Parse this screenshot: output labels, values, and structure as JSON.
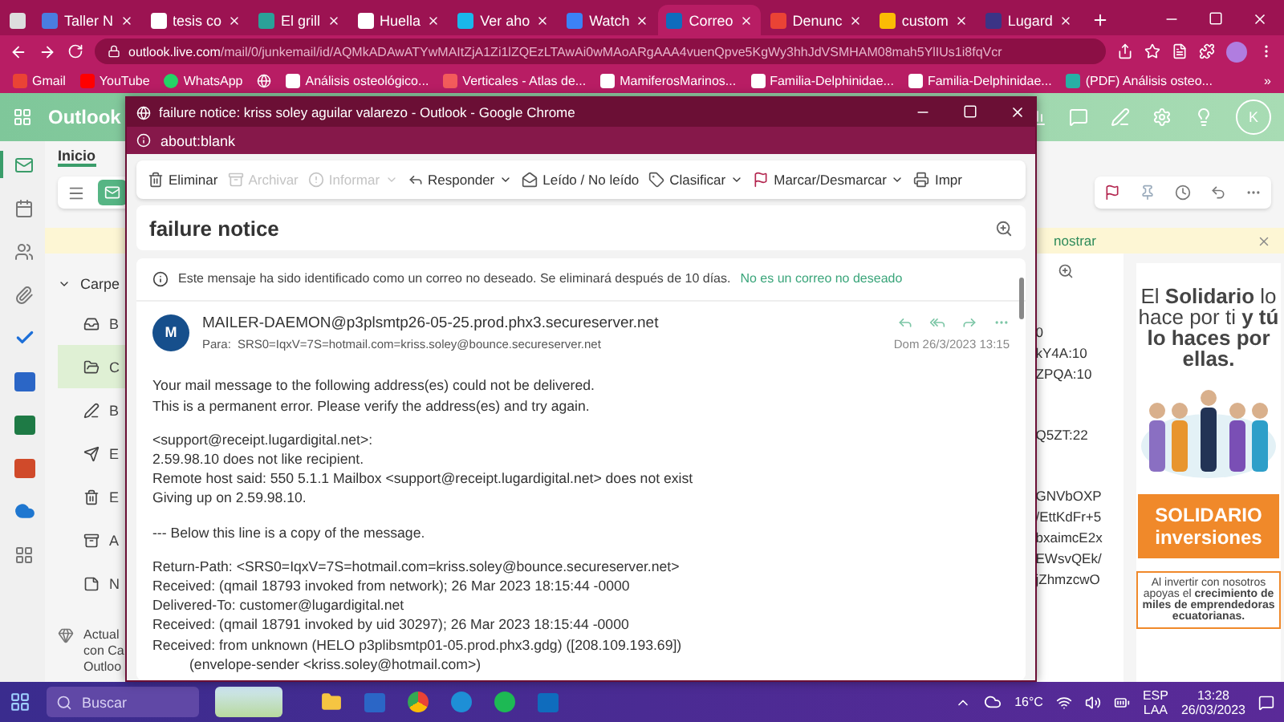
{
  "browser": {
    "tabs": [
      {
        "label": "Taller N",
        "selected": false
      },
      {
        "label": "tesis co",
        "selected": false
      },
      {
        "label": "El grill",
        "selected": false
      },
      {
        "label": "Huella",
        "selected": false
      },
      {
        "label": "Ver aho",
        "selected": false
      },
      {
        "label": "Watch",
        "selected": false
      },
      {
        "label": "Correo",
        "selected": true
      },
      {
        "label": "Denunc",
        "selected": false
      },
      {
        "label": "custom",
        "selected": false
      },
      {
        "label": "Lugard",
        "selected": false
      }
    ],
    "url_host": "outlook.live.com",
    "url_path": "/mail/0/junkemail/id/AQMkADAwATYwMAItZjA1Zi1lZQEzLTAwAi0wMAoARgAAA4vuenQpve5KgWy3hhJdVSMHAM08mah5YlIUs1i8fqVcr",
    "bookmarks": [
      "Gmail",
      "YouTube",
      "WhatsApp",
      "Análisis osteológico...",
      "Verticales - Atlas de...",
      "MamiferosMarinos...",
      "Familia-Delphinidae...",
      "Familia-Delphinidae...",
      "(PDF) Análisis osteo..."
    ],
    "bookmarks_more": "»"
  },
  "outlook": {
    "app_name": "Outlook",
    "avatar_initial": "K",
    "rail": [
      {
        "selected": true
      },
      {
        "selected": false
      },
      {
        "selected": false
      },
      {
        "selected": false
      },
      {
        "selected": false
      },
      {
        "selected": false
      },
      {
        "selected": false
      },
      {
        "selected": false
      },
      {
        "selected": false
      },
      {
        "selected": false
      }
    ],
    "ribbon_tab": "Inicio",
    "banner_link": "nostrar",
    "folders_header": "Carpe",
    "folders": [
      {
        "label": "B",
        "selected": false
      },
      {
        "label": "C",
        "selected": true
      },
      {
        "label": "B",
        "selected": false
      },
      {
        "label": "E",
        "selected": false
      },
      {
        "label": "E",
        "selected": false
      },
      {
        "label": "A",
        "selected": false
      },
      {
        "label": "N",
        "selected": false
      }
    ],
    "upgrade_lines": [
      "Actual",
      "con Ca",
      "Outloo"
    ],
    "reading_fragments": [
      [
        "0",
        "kY4A:10",
        "ZPQA:10"
      ],
      [
        "Q5ZT:22"
      ],
      [
        "GNVbOXP",
        "/EttKdFr+5",
        "bxaimcE2x",
        "EWsvQEk/",
        "jZhmzcwO"
      ]
    ],
    "ad": {
      "headline": "El **Solidario** lo hace por ti **y tú lo haces por ellas.**",
      "brand": "SOLIDARIO",
      "product": "inversiones",
      "text": "Al invertir con nosotros apoyas el **crecimiento de miles de emprendedoras ecuatorianas.**"
    }
  },
  "popup": {
    "title": "failure notice: kriss soley aguilar valarezo - Outlook - Google Chrome",
    "address": "about:blank",
    "toolbar": [
      {
        "label": "Eliminar",
        "disabled": false,
        "dropdown": false
      },
      {
        "label": "Archivar",
        "disabled": true,
        "dropdown": false
      },
      {
        "label": "Informar",
        "disabled": true,
        "dropdown": true
      },
      {
        "label": "Responder",
        "disabled": false,
        "dropdown": true
      },
      {
        "label": "Leído / No leído",
        "disabled": false,
        "dropdown": false
      },
      {
        "label": "Clasificar",
        "disabled": false,
        "dropdown": true
      },
      {
        "label": "Marcar/Desmarcar",
        "disabled": false,
        "dropdown": true
      },
      {
        "label": "Impr",
        "disabled": false,
        "dropdown": false
      }
    ],
    "subject": "failure notice",
    "junk_notice": "Este mensaje ha sido identificado como un correo no deseado. Se eliminará después de 10 días.",
    "junk_link": "No es un correo no deseado",
    "sender_initial": "M",
    "sender": "MAILER-DAEMON@p3plsmtp26-05-25.prod.phx3.secureserver.net",
    "to_label": "Para:",
    "to": "SRS0=IqxV=7S=hotmail.com=kriss.soley@bounce.secureserver.net",
    "date": "Dom 26/3/2023 13:15",
    "body": [
      [
        {
          "text": "Your mail message to the following address(es) could not be delivered.",
          "indented": false
        },
        {
          "text": "This is a permanent error. Please verify the address(es) and try again.",
          "indented": false
        }
      ],
      [
        {
          "text": "<support@receipt.lugardigital.net>:",
          "indented": false
        },
        {
          "text": "2.59.98.10 does not like recipient.",
          "indented": false
        },
        {
          "text": "Remote host said: 550 5.1.1 Mailbox <support@receipt.lugardigital.net> does not exist",
          "indented": false
        },
        {
          "text": "Giving up on 2.59.98.10.",
          "indented": false
        }
      ],
      [
        {
          "text": "--- Below this line is a copy of the message.",
          "indented": false
        }
      ],
      [
        {
          "text": "Return-Path: <SRS0=IqxV=7S=hotmail.com=kriss.soley@bounce.secureserver.net>",
          "indented": false
        },
        {
          "text": "Received: (qmail 18793 invoked from network); 26 Mar 2023 18:15:44 -0000",
          "indented": false
        },
        {
          "text": "Delivered-To: customer@lugardigital.net",
          "indented": false
        },
        {
          "text": "Received: (qmail 18791 invoked by uid 30297); 26 Mar 2023 18:15:44 -0000",
          "indented": false
        },
        {
          "text": "Received: from unknown (HELO p3plibsmtp01-05.prod.phx3.gdg) ([208.109.193.69])",
          "indented": false
        },
        {
          "text": "(envelope-sender <kriss.soley@hotmail.com>)",
          "indented": true
        }
      ]
    ]
  },
  "taskbar": {
    "search_placeholder": "Buscar",
    "weather": "16°C",
    "language": "ESP",
    "layout": "LAA",
    "time": "13:28",
    "date": "26/03/2023"
  }
}
